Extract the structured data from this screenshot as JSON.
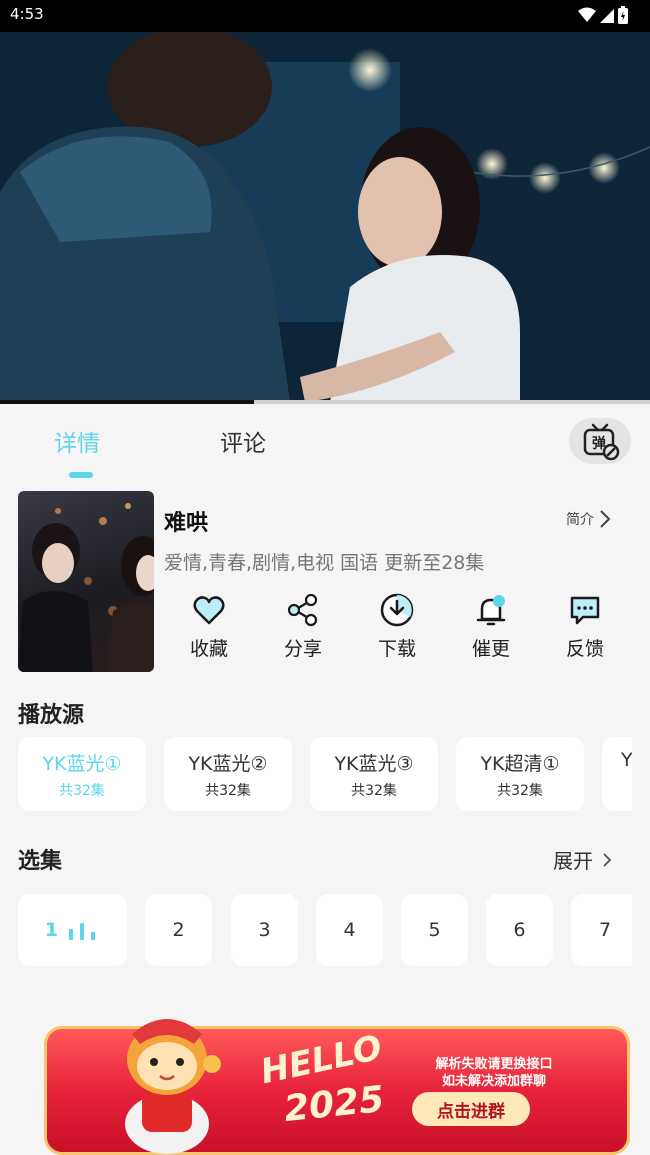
{
  "status_bar": {
    "time": "4:53",
    "icons": [
      "wifi-icon",
      "cellular-signal-icon",
      "battery-icon"
    ]
  },
  "player": {
    "progress": 0.39
  },
  "tabs": {
    "items": [
      {
        "label": "详情",
        "active": true
      },
      {
        "label": "评论",
        "active": false
      }
    ],
    "danmaku_icon": "danmaku-tv-icon",
    "danmaku_glyph": "弹"
  },
  "show": {
    "title": "难哄",
    "intro_label": "简介",
    "meta": "爱情,青春,剧情,电视 国语 更新至28集"
  },
  "actions": [
    {
      "label": "收藏",
      "icon": "heart-icon"
    },
    {
      "label": "分享",
      "icon": "share-icon"
    },
    {
      "label": "下载",
      "icon": "download-icon"
    },
    {
      "label": "催更",
      "icon": "bell-icon"
    },
    {
      "label": "反馈",
      "icon": "feedback-icon"
    }
  ],
  "sources": {
    "title": "播放源",
    "items": [
      {
        "name": "YK蓝光①",
        "count": "共32集",
        "active": true
      },
      {
        "name": "YK蓝光②",
        "count": "共32集",
        "active": false
      },
      {
        "name": "YK蓝光③",
        "count": "共32集",
        "active": false
      },
      {
        "name": "YK超清①",
        "count": "共32集",
        "active": false
      },
      {
        "name": "Y",
        "count": "",
        "active": false
      }
    ]
  },
  "episodes": {
    "title": "选集",
    "expand_label": "展开",
    "items": [
      "1",
      "2",
      "3",
      "4",
      "5",
      "6",
      "7"
    ],
    "current": "1"
  },
  "banner": {
    "hello": "HELLO",
    "year": "2025",
    "line1": "解析失败请更换接口",
    "line2": "如未解决添加群聊",
    "cta": "点击进群"
  },
  "colors": {
    "accent": "#5ed5ec",
    "background": "#f5f5f5",
    "banner_red": "#e7233a"
  }
}
